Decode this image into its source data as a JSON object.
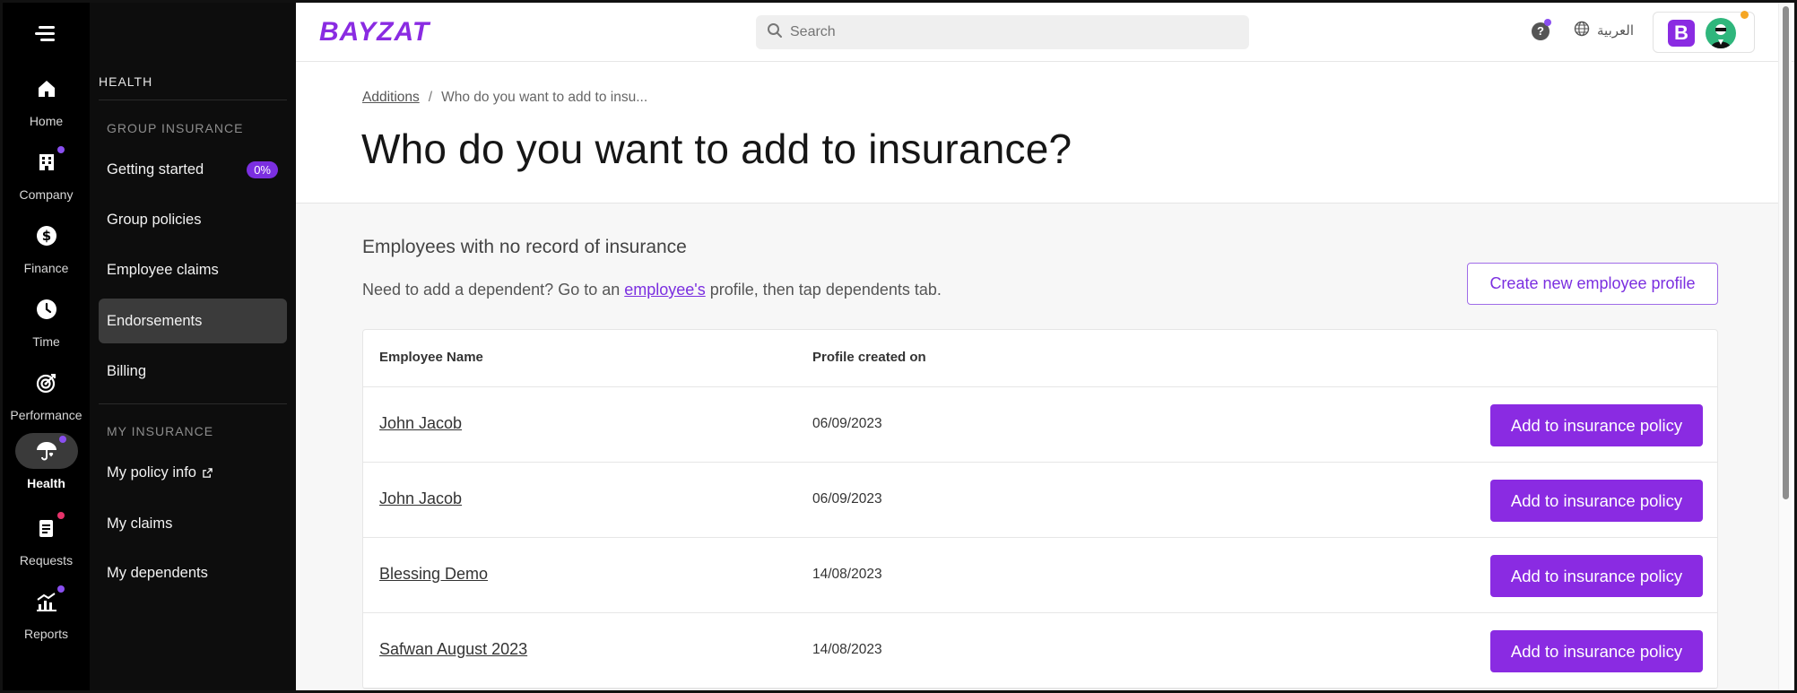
{
  "rail": {
    "items": [
      {
        "label": "Home",
        "icon": "home-icon"
      },
      {
        "label": "Company",
        "icon": "building-icon"
      },
      {
        "label": "Finance",
        "icon": "dollar-icon"
      },
      {
        "label": "Time",
        "icon": "clock-icon"
      },
      {
        "label": "Performance",
        "icon": "target-icon"
      },
      {
        "label": "Health",
        "icon": "health-umbrella-icon"
      },
      {
        "label": "Requests",
        "icon": "clipboard-icon"
      },
      {
        "label": "Reports",
        "icon": "chart-icon"
      }
    ]
  },
  "subnav": {
    "section_title": "HEALTH",
    "group_insurance": "GROUP INSURANCE",
    "getting_started": "Getting started",
    "getting_started_badge": "0%",
    "group_policies": "Group policies",
    "employee_claims": "Employee claims",
    "endorsements": "Endorsements",
    "billing": "Billing",
    "my_insurance": "MY INSURANCE",
    "my_policy_info": "My policy info",
    "my_claims": "My claims",
    "my_dependents": "My dependents"
  },
  "topbar": {
    "logo": "BAYZAT",
    "search_placeholder": "Search",
    "language": "العربية",
    "company_initial": "B"
  },
  "breadcrumb": {
    "parent": "Additions",
    "current": "Who do you want to add to insu..."
  },
  "page": {
    "title": "Who do you want to add to insurance?",
    "section_title": "Employees with no record of insurance",
    "desc_before": "Need to add a dependent? Go to an ",
    "desc_link": "employee's",
    "desc_after": " profile, then tap dependents tab.",
    "create_button": "Create new employee profile"
  },
  "table": {
    "headers": {
      "name": "Employee Name",
      "created": "Profile created on"
    },
    "rows": [
      {
        "name": "John Jacob",
        "created": "06/09/2023",
        "action": "Add to insurance policy"
      },
      {
        "name": "John Jacob",
        "created": "06/09/2023",
        "action": "Add to insurance policy"
      },
      {
        "name": "Blessing Demo",
        "created": "14/08/2023",
        "action": "Add to insurance policy"
      },
      {
        "name": "Safwan August 2023",
        "created": "14/08/2023",
        "action": "Add to insurance policy"
      }
    ]
  },
  "colors": {
    "brand": "#8a2be2",
    "rail_bg": "#000000",
    "subnav_bg": "#0d0d0d",
    "notif_purple": "#8a4ff0",
    "notif_red": "#e6336b",
    "notif_orange": "#f5a623"
  }
}
